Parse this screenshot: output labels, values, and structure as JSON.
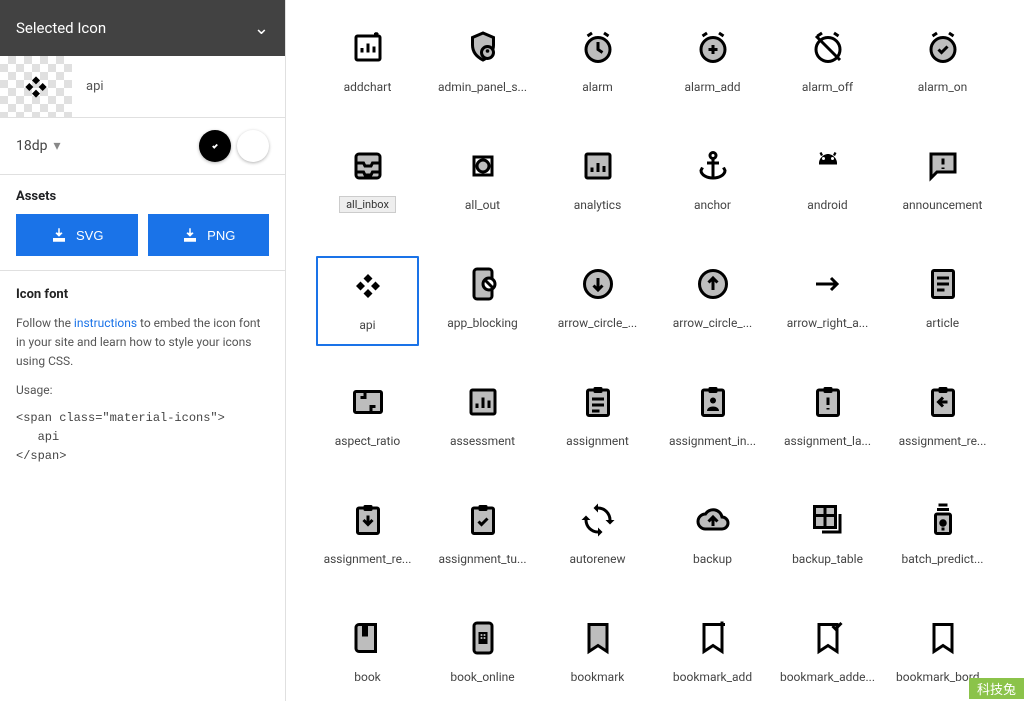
{
  "sidebar": {
    "header": "Selected Icon",
    "preview_name": "api",
    "size": "18dp",
    "assets_title": "Assets",
    "svg_btn": "SVG",
    "png_btn": "PNG",
    "iconfont_title": "Icon font",
    "instructions_prefix": "Follow the ",
    "instructions_link": "instructions",
    "instructions_suffix": " to embed the icon font in your site and learn how to style your icons using CSS.",
    "usage_label": "Usage:",
    "code": "<span class=\"material-icons\">\n   api\n</span>"
  },
  "hover_tooltip": "all_inbox",
  "icons": [
    {
      "id": "addchart",
      "label": "addchart"
    },
    {
      "id": "admin_panel_settings",
      "label": "admin_panel_s..."
    },
    {
      "id": "alarm",
      "label": "alarm"
    },
    {
      "id": "alarm_add",
      "label": "alarm_add"
    },
    {
      "id": "alarm_off",
      "label": "alarm_off"
    },
    {
      "id": "alarm_on",
      "label": "alarm_on"
    },
    {
      "id": "all_inbox",
      "label": "all_inbox",
      "hover": true
    },
    {
      "id": "all_out",
      "label": "all_out"
    },
    {
      "id": "analytics",
      "label": "analytics"
    },
    {
      "id": "anchor",
      "label": "anchor"
    },
    {
      "id": "android",
      "label": "android"
    },
    {
      "id": "announcement",
      "label": "announcement"
    },
    {
      "id": "api",
      "label": "api",
      "selected": true
    },
    {
      "id": "app_blocking",
      "label": "app_blocking"
    },
    {
      "id": "arrow_circle_down",
      "label": "arrow_circle_..."
    },
    {
      "id": "arrow_circle_up",
      "label": "arrow_circle_..."
    },
    {
      "id": "arrow_right_alt",
      "label": "arrow_right_a..."
    },
    {
      "id": "article",
      "label": "article"
    },
    {
      "id": "aspect_ratio",
      "label": "aspect_ratio"
    },
    {
      "id": "assessment",
      "label": "assessment"
    },
    {
      "id": "assignment",
      "label": "assignment"
    },
    {
      "id": "assignment_ind",
      "label": "assignment_in..."
    },
    {
      "id": "assignment_late",
      "label": "assignment_la..."
    },
    {
      "id": "assignment_return",
      "label": "assignment_re..."
    },
    {
      "id": "assignment_returned",
      "label": "assignment_re..."
    },
    {
      "id": "assignment_turned_in",
      "label": "assignment_tu..."
    },
    {
      "id": "autorenew",
      "label": "autorenew"
    },
    {
      "id": "backup",
      "label": "backup"
    },
    {
      "id": "backup_table",
      "label": "backup_table"
    },
    {
      "id": "batch_prediction",
      "label": "batch_predict..."
    },
    {
      "id": "book",
      "label": "book"
    },
    {
      "id": "book_online",
      "label": "book_online"
    },
    {
      "id": "bookmark",
      "label": "bookmark"
    },
    {
      "id": "bookmark_add",
      "label": "bookmark_add"
    },
    {
      "id": "bookmark_added",
      "label": "bookmark_adde..."
    },
    {
      "id": "bookmark_border",
      "label": "bookmark_bord..."
    }
  ],
  "watermark": "科技兔"
}
